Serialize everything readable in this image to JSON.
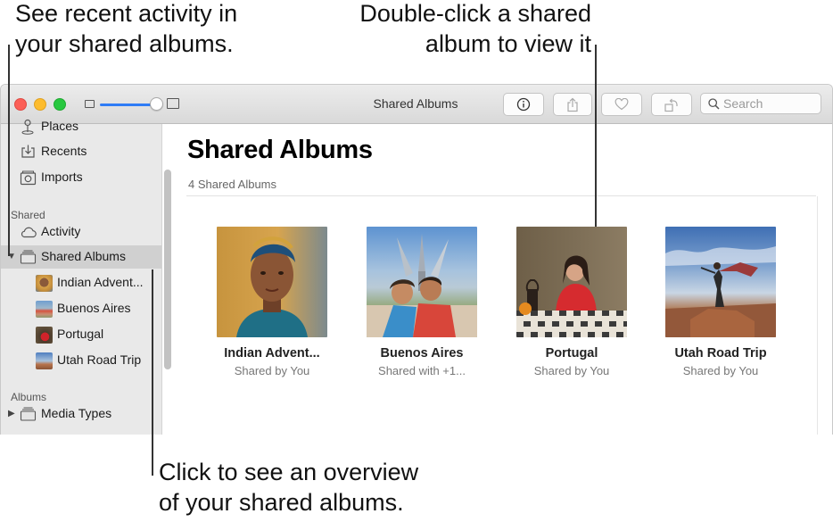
{
  "callouts": {
    "top_left": [
      "See recent activity in",
      "your shared albums."
    ],
    "top_right": [
      "Double-click a shared",
      "album to view it"
    ],
    "bottom": [
      "Click to see an overview",
      "of your shared albums."
    ]
  },
  "window": {
    "title": "Shared Albums",
    "search_placeholder": "Search"
  },
  "toolbar": {
    "info_icon": "info-icon",
    "share_icon": "share-icon",
    "favorite_icon": "heart-icon",
    "rotate_icon": "rotate-icon"
  },
  "sidebar": {
    "items_top": [
      {
        "label": "Places",
        "icon": "pin-icon"
      },
      {
        "label": "Recents",
        "icon": "recents-icon"
      },
      {
        "label": "Imports",
        "icon": "imports-icon"
      }
    ],
    "shared_header": "Shared",
    "activity": "Activity",
    "shared_albums": "Shared Albums",
    "shared_children": [
      {
        "label": "Indian Advent..."
      },
      {
        "label": "Buenos Aires"
      },
      {
        "label": "Portugal"
      },
      {
        "label": "Utah Road Trip"
      }
    ],
    "albums_header": "Albums",
    "media_types": "Media Types"
  },
  "main": {
    "heading": "Shared Albums",
    "count": "4 Shared Albums",
    "albums": [
      {
        "name": "Indian Advent...",
        "shared_by": "Shared by You"
      },
      {
        "name": "Buenos Aires",
        "shared_by": "Shared with +1..."
      },
      {
        "name": "Portugal",
        "shared_by": "Shared by You"
      },
      {
        "name": "Utah Road Trip",
        "shared_by": "Shared by You"
      }
    ]
  },
  "colors": {
    "accent": "#2f7cf6",
    "sidebar_bg": "#e9e9e9",
    "selected_bg": "#d0d0d0"
  }
}
